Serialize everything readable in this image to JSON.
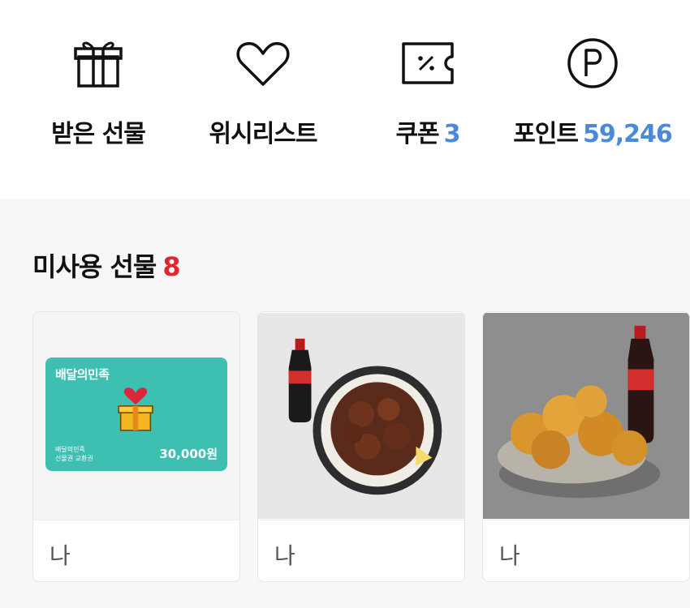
{
  "quick_actions": [
    {
      "icon": "gift-icon",
      "label": "받은 선물"
    },
    {
      "icon": "heart-icon",
      "label": "위시리스트"
    },
    {
      "icon": "coupon-icon",
      "label": "쿠폰",
      "count": "3"
    },
    {
      "icon": "point-icon",
      "label": "포인트",
      "count": "59,246"
    }
  ],
  "section": {
    "title": "미사용 선물",
    "count": "8"
  },
  "gift_card": {
    "brand": "배달의민족",
    "caption_line1": "배달의민족",
    "caption_line2": "선물권 교환권",
    "amount": "30,000원"
  },
  "cards": [
    {
      "footer": "나"
    },
    {
      "footer": "나"
    },
    {
      "footer": "나"
    }
  ],
  "colors": {
    "accent_blue": "#4a8ad8",
    "accent_red": "#e5242f",
    "baemin_mint": "#3dbfb2"
  }
}
